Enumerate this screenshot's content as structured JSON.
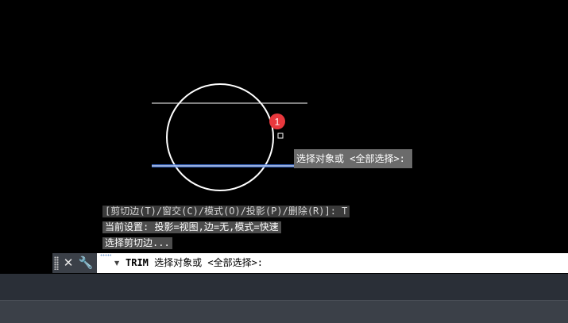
{
  "drawing": {
    "grip_marker_number": "1"
  },
  "tooltip": {
    "text": "选择对象或 <全部选择>:"
  },
  "command_history": [
    " [剪切边(T)/窗交(C)/模式(O)/投影(P)/删除(R)]: T",
    "当前设置: 投影=视图,边=无,模式=快速",
    "选择剪切边..."
  ],
  "command_line": {
    "keyword": "TRIM",
    "prompt": " 选择对象或 <全部选择>:",
    "close_icon": "close-icon",
    "customize_icon": "wrench-icon"
  },
  "colors": {
    "background": "#000000",
    "geometry": "#ffffff",
    "highlight": "#3a6fd8",
    "marker": "#e8383d",
    "panel": "#3b4048"
  }
}
